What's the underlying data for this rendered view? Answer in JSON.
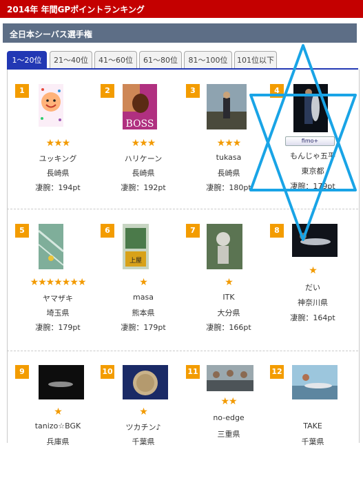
{
  "header": {
    "title": "2014年 年間GPポイントランキング"
  },
  "section": {
    "title": "全日本シーバス選手権"
  },
  "tabs": [
    "1〜20位",
    "21〜40位",
    "41〜60位",
    "61〜80位",
    "81〜100位",
    "101位以下"
  ],
  "active_tab": 0,
  "entries": [
    {
      "rank": "1",
      "stars": "★★★",
      "name": "ユッキング",
      "pref": "長崎県",
      "points": "凄腕：194pt"
    },
    {
      "rank": "2",
      "stars": "★★★",
      "name": "ハリケーン",
      "pref": "長崎県",
      "points": "凄腕：192pt"
    },
    {
      "rank": "3",
      "stars": "★★★",
      "name": "tukasa",
      "pref": "長崎県",
      "points": "凄腕：180pt"
    },
    {
      "rank": "4",
      "stars": "",
      "name": "もんじゃ五平",
      "pref": "東京都",
      "points": "凄腕：179pt",
      "badge": "fimo+"
    },
    {
      "rank": "5",
      "stars": "★★★★★★★",
      "name": "ヤマザキ",
      "pref": "埼玉県",
      "points": "凄腕：179pt"
    },
    {
      "rank": "6",
      "stars": "★",
      "name": "masa",
      "pref": "熊本県",
      "points": "凄腕：179pt"
    },
    {
      "rank": "7",
      "stars": "★",
      "name": "ITK",
      "pref": "大分県",
      "points": "凄腕：166pt"
    },
    {
      "rank": "8",
      "stars": "★",
      "name": "だい",
      "pref": "神奈川県",
      "points": "凄腕：164pt"
    },
    {
      "rank": "9",
      "stars": "★",
      "name": "tanizo☆BGK",
      "pref": "兵庫県",
      "points": ""
    },
    {
      "rank": "10",
      "stars": "★",
      "name": "ツカチン♪",
      "pref": "千葉県",
      "points": ""
    },
    {
      "rank": "11",
      "stars": "★★",
      "name": "no-edge",
      "pref": "三重県",
      "points": ""
    },
    {
      "rank": "12",
      "stars": "",
      "name": "TAKE",
      "pref": "千葉県",
      "points": ""
    }
  ],
  "thumb_boss_text": "BOSS",
  "thumb_masa_text": "上屋"
}
